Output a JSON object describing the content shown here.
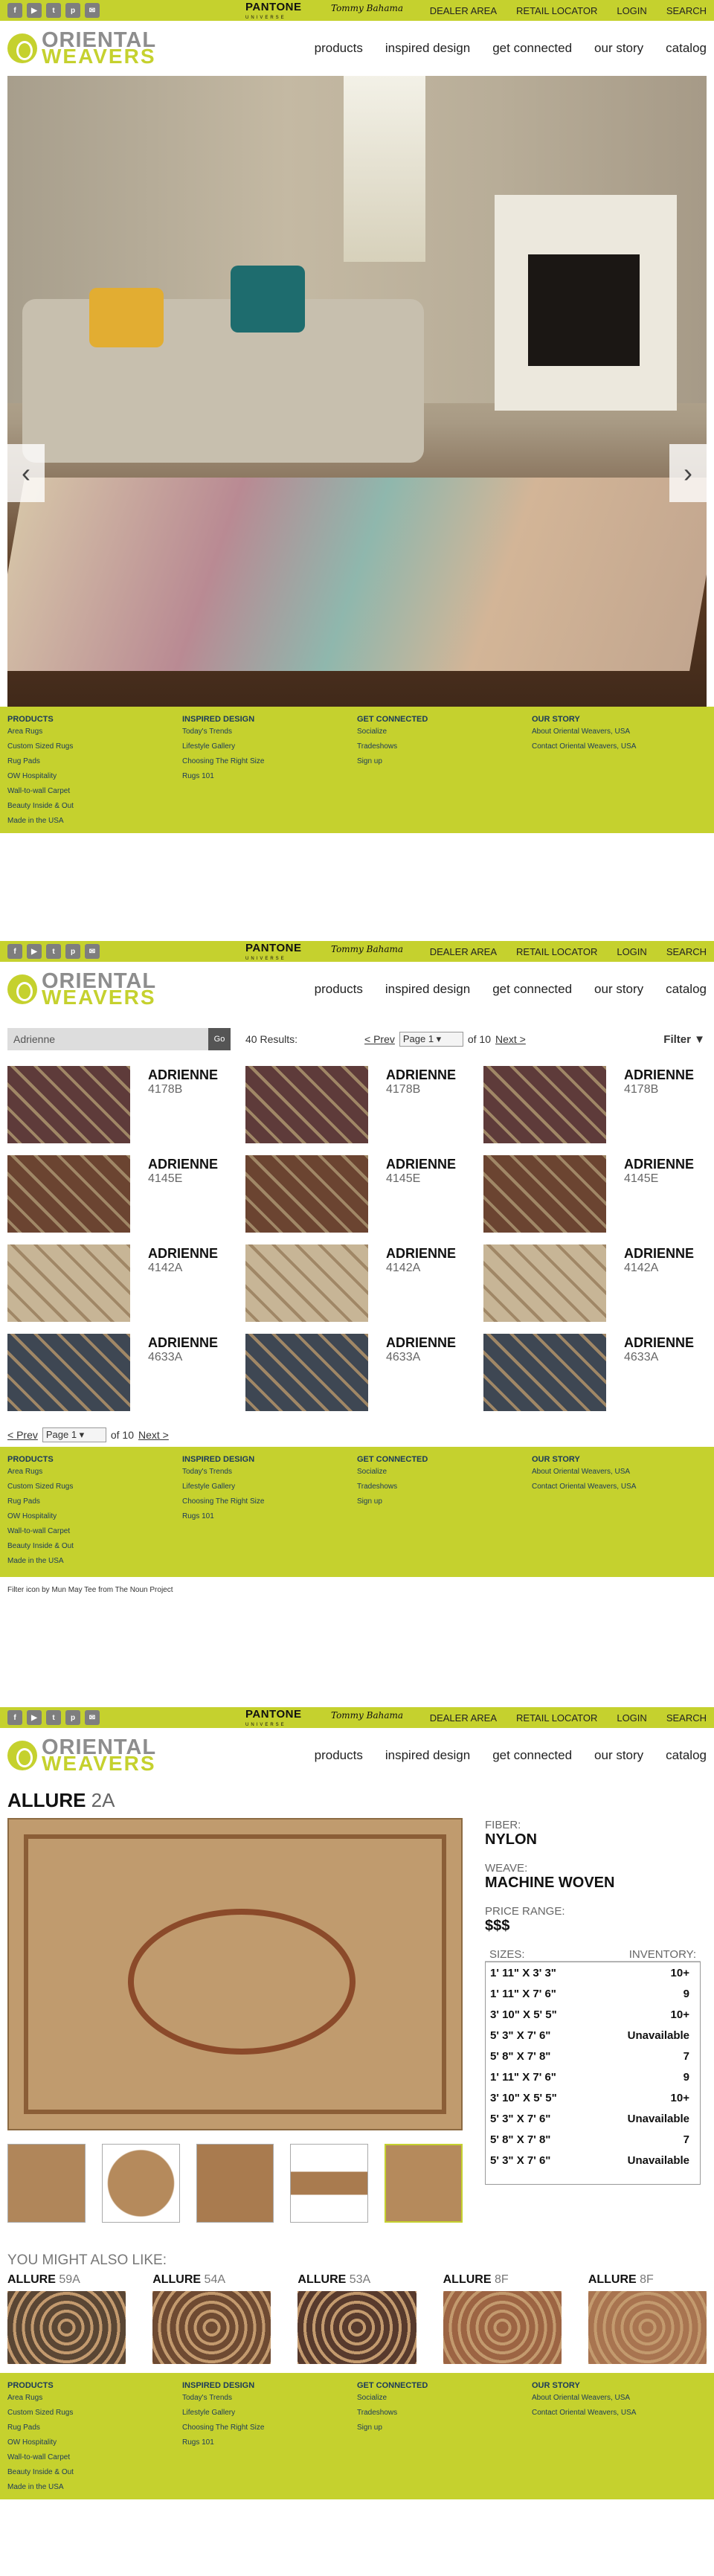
{
  "header": {
    "social_icons": [
      "facebook-icon",
      "youtube-icon",
      "twitter-icon",
      "pinterest-icon",
      "email-icon"
    ],
    "brand_pantone": "PANTONE",
    "brand_pantone_sub": "UNIVERSE",
    "brand_tommy": "Tommy Bahama",
    "top_links": [
      "DEALER AREA",
      "RETAIL LOCATOR",
      "LOGIN",
      "SEARCH"
    ],
    "logo_line1": "ORIENTAL",
    "logo_line2": "WEAVERS",
    "nav": [
      "products",
      "inspired design",
      "get connected",
      "our story",
      "catalog"
    ]
  },
  "footer": {
    "col1": {
      "title": "PRODUCTS",
      "items": [
        "Area Rugs",
        "Custom Sized Rugs",
        "Rug Pads",
        "OW Hospitality",
        "Wall-to-wall Carpet",
        "Beauty Inside & Out",
        "Made in the USA"
      ]
    },
    "col2": {
      "title": "INSPIRED DESIGN",
      "items": [
        "Today's Trends",
        "Lifestyle Gallery",
        "Choosing The Right Size",
        "Rugs 101"
      ]
    },
    "col3": {
      "title": "GET CONNECTED",
      "items": [
        "Socialize",
        "Tradeshows",
        "Sign up"
      ]
    },
    "col4": {
      "title": "OUR STORY",
      "items": [
        "About Oriental Weavers, USA",
        "Contact Oriental Weavers, USA"
      ]
    }
  },
  "search": {
    "query": "Adrienne",
    "go": "Go",
    "results": "40 Results:",
    "prev": "< Prev",
    "page": "Page 1",
    "of": "of 10",
    "next": "Next >",
    "filter": "Filter"
  },
  "products": [
    {
      "name": "ADRIENNE",
      "code": "4178B",
      "color": "#5e3b3a"
    },
    {
      "name": "ADRIENNE",
      "code": "4178B",
      "color": "#5e3b3a"
    },
    {
      "name": "ADRIENNE",
      "code": "4178B",
      "color": "#5e3b3a"
    },
    {
      "name": "ADRIENNE",
      "code": "4145E",
      "color": "#6b4431"
    },
    {
      "name": "ADRIENNE",
      "code": "4145E",
      "color": "#6b4431"
    },
    {
      "name": "ADRIENNE",
      "code": "4145E",
      "color": "#6b4431"
    },
    {
      "name": "ADRIENNE",
      "code": "4142A",
      "color": "#c7b596"
    },
    {
      "name": "ADRIENNE",
      "code": "4142A",
      "color": "#c7b596"
    },
    {
      "name": "ADRIENNE",
      "code": "4142A",
      "color": "#c7b596"
    },
    {
      "name": "ADRIENNE",
      "code": "4633A",
      "color": "#3e4753"
    },
    {
      "name": "ADRIENNE",
      "code": "4633A",
      "color": "#3e4753"
    },
    {
      "name": "ADRIENNE",
      "code": "4633A",
      "color": "#3e4753"
    }
  ],
  "credit": "Filter icon by Mun May Tee from The Noun Project",
  "detail": {
    "name": "ALLURE",
    "code": "2A",
    "fiber_label": "FIBER:",
    "fiber": "NYLON",
    "weave_label": "WEAVE:",
    "weave": "MACHINE WOVEN",
    "price_label": "PRICE RANGE:",
    "price": "$$$",
    "sizes_label": "SIZES:",
    "inventory_label": "INVENTORY:",
    "sizes": [
      {
        "size": "1' 11\" X 3' 3\"",
        "inv": "10+"
      },
      {
        "size": "1' 11\" X 7' 6\"",
        "inv": "9"
      },
      {
        "size": "3' 10\" X 5' 5\"",
        "inv": "10+"
      },
      {
        "size": "5' 3\" X 7' 6\"",
        "inv": "Unavailable"
      },
      {
        "size": "5' 8\" X 7' 8\"",
        "inv": "7"
      },
      {
        "size": "1' 11\" X 7' 6\"",
        "inv": "9"
      },
      {
        "size": "3' 10\" X 5' 5\"",
        "inv": "10+"
      },
      {
        "size": "5' 3\" X 7' 6\"",
        "inv": "Unavailable"
      },
      {
        "size": "5' 8\" X 7' 8\"",
        "inv": "7"
      },
      {
        "size": "5' 3\" X 7' 6\"",
        "inv": "Unavailable"
      }
    ],
    "also_title": "YOU MIGHT ALSO LIKE:",
    "also": [
      {
        "name": "ALLURE",
        "code": "59A",
        "color": "#5a4634"
      },
      {
        "name": "ALLURE",
        "code": "54A",
        "color": "#6e4a32"
      },
      {
        "name": "ALLURE",
        "code": "53A",
        "color": "#573a2d"
      },
      {
        "name": "ALLURE",
        "code": "8F",
        "color": "#9c6443"
      },
      {
        "name": "ALLURE",
        "code": "8F",
        "color": "#a87450"
      }
    ]
  }
}
